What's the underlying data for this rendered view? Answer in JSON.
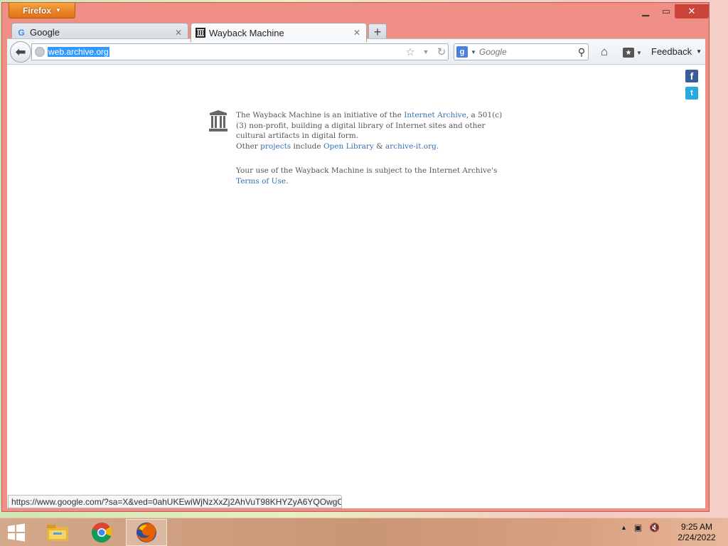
{
  "browser": {
    "menu_button": "Firefox",
    "tabs": [
      {
        "label": "Google",
        "active": false
      },
      {
        "label": "Wayback Machine",
        "active": true
      }
    ],
    "url": "web.archive.org",
    "search": {
      "placeholder": "Google",
      "engine_icon": "google-plus-icon"
    },
    "feedback_label": "Feedback",
    "status_url": "https://www.google.com/?sa=X&ved=0ahUKEwiWjNzXxZj2AhVuT98KHYZyA6YQOwgC"
  },
  "page": {
    "about": {
      "intro": "The Wayback Machine is an initiative of the ",
      "link_ia": "Internet Archive",
      "middle": ", a 501(c)(3) non-profit, building a digital library of Internet sites and other cultural artifacts in digital form.",
      "other": "Other ",
      "link_projects": "projects",
      "include": " include ",
      "link_open_library": "Open Library",
      "amp": " & ",
      "link_archive_it": "archive-it.org",
      "end": "."
    },
    "terms": {
      "text": "Your use of the Wayback Machine is subject to the Internet Archive's ",
      "link": "Terms of Use",
      "end": "."
    },
    "social": {
      "facebook": "f",
      "twitter": "t"
    }
  },
  "taskbar": {
    "time": "9:25 AM",
    "date": "2/24/2022",
    "apps": [
      "file-explorer-icon",
      "chrome-icon",
      "firefox-icon"
    ]
  },
  "colors": {
    "window_frame": "#f08f86",
    "close_button": "#c9443b",
    "link": "#3572b0",
    "url_selection": "#3399ff"
  }
}
